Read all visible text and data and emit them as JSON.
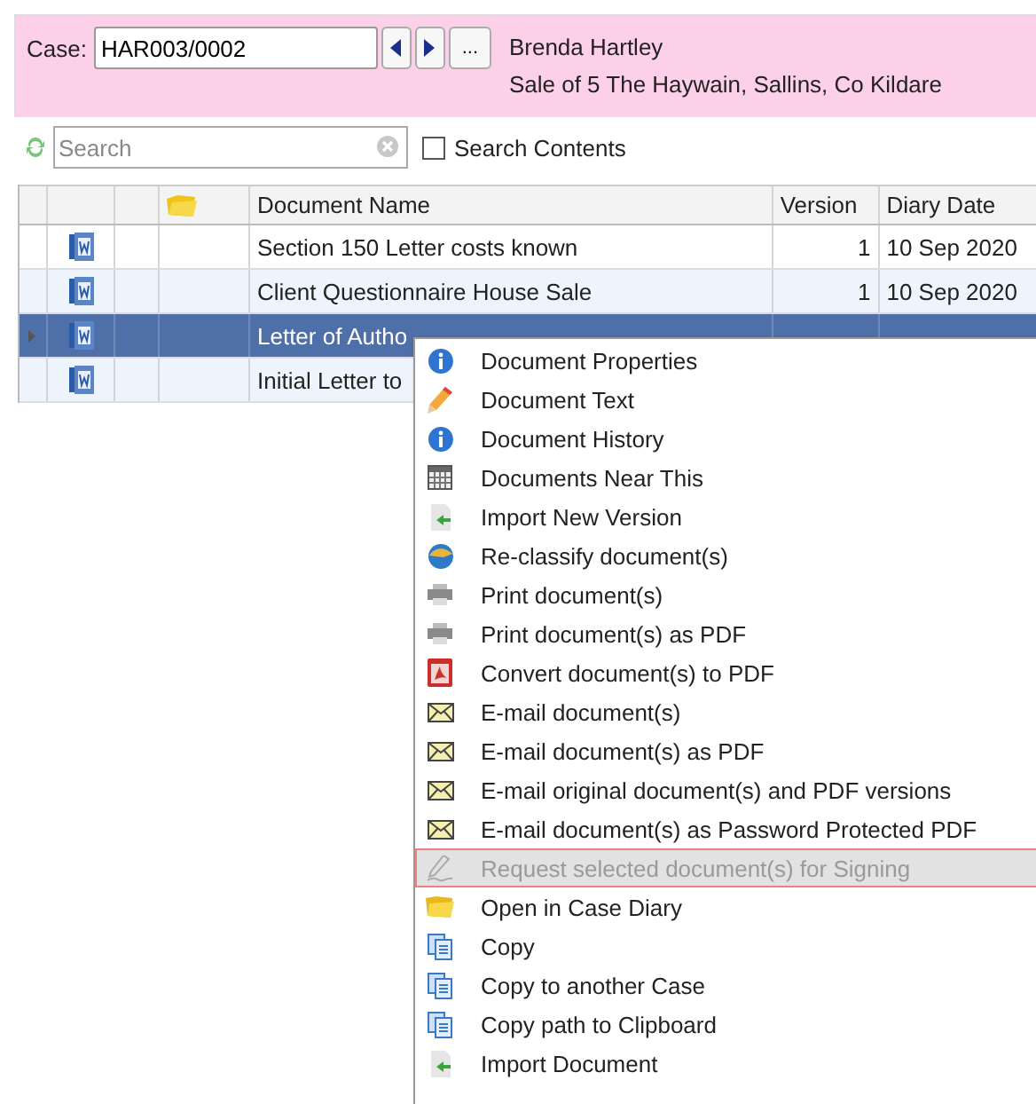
{
  "case_bar": {
    "label": "Case:",
    "case_number": "HAR003/0002",
    "browse_button": "...",
    "client_name": "Brenda Hartley",
    "matter": "Sale of 5 The Haywain, Sallins, Co Kildare"
  },
  "search": {
    "placeholder": "Search",
    "search_contents": {
      "label": "Search Contents",
      "checked": false
    }
  },
  "table": {
    "columns": [
      "Document Name",
      "Version",
      "Diary Date"
    ],
    "rows": [
      {
        "selected": false,
        "name": "Section 150 Letter costs known",
        "version": "1",
        "date": "10 Sep 2020"
      },
      {
        "selected": false,
        "name": "Client Questionnaire House Sale",
        "version": "1",
        "date": "10 Sep 2020"
      },
      {
        "selected": true,
        "name": "Letter of Autho"
      },
      {
        "selected": false,
        "name": "Initial Letter to"
      }
    ]
  },
  "context_menu": {
    "items": [
      {
        "kind": "info",
        "label": "Document Properties",
        "disabled": false,
        "selected": false
      },
      {
        "kind": "pencil",
        "label": "Document Text",
        "disabled": false,
        "selected": false
      },
      {
        "kind": "info",
        "label": "Document History",
        "disabled": false,
        "selected": false
      },
      {
        "kind": "calendar",
        "label": "Documents Near This",
        "disabled": false,
        "selected": false
      },
      {
        "kind": "import",
        "label": "Import New Version",
        "disabled": false,
        "selected": false
      },
      {
        "kind": "reclassify",
        "label": "Re-classify document(s)",
        "disabled": false,
        "selected": false
      },
      {
        "kind": "printer",
        "label": "Print document(s)",
        "disabled": false,
        "selected": false
      },
      {
        "kind": "printer",
        "label": "Print document(s) as PDF",
        "disabled": false,
        "selected": false
      },
      {
        "kind": "pdf",
        "label": "Convert document(s) to PDF",
        "disabled": false,
        "selected": false
      },
      {
        "kind": "mail",
        "label": "E-mail document(s)",
        "disabled": false,
        "selected": false
      },
      {
        "kind": "mail",
        "label": "E-mail document(s) as PDF",
        "disabled": false,
        "selected": false
      },
      {
        "kind": "mail",
        "label": "E-mail original document(s) and PDF versions",
        "disabled": false,
        "selected": false
      },
      {
        "kind": "mail",
        "label": "E-mail document(s) as Password Protected PDF",
        "disabled": false,
        "selected": false
      },
      {
        "kind": "sign",
        "label": "Request selected document(s) for Signing",
        "disabled": true,
        "selected": true
      },
      {
        "kind": "folder",
        "label": "Open in Case Diary",
        "disabled": false,
        "selected": false
      },
      {
        "kind": "copy",
        "label": "Copy",
        "disabled": false,
        "selected": false
      },
      {
        "kind": "copy",
        "label": "Copy to another Case",
        "disabled": false,
        "selected": false
      },
      {
        "kind": "copy",
        "label": "Copy path to Clipboard",
        "disabled": false,
        "selected": false
      },
      {
        "kind": "import",
        "label": "Import Document",
        "disabled": false,
        "selected": false
      }
    ]
  }
}
